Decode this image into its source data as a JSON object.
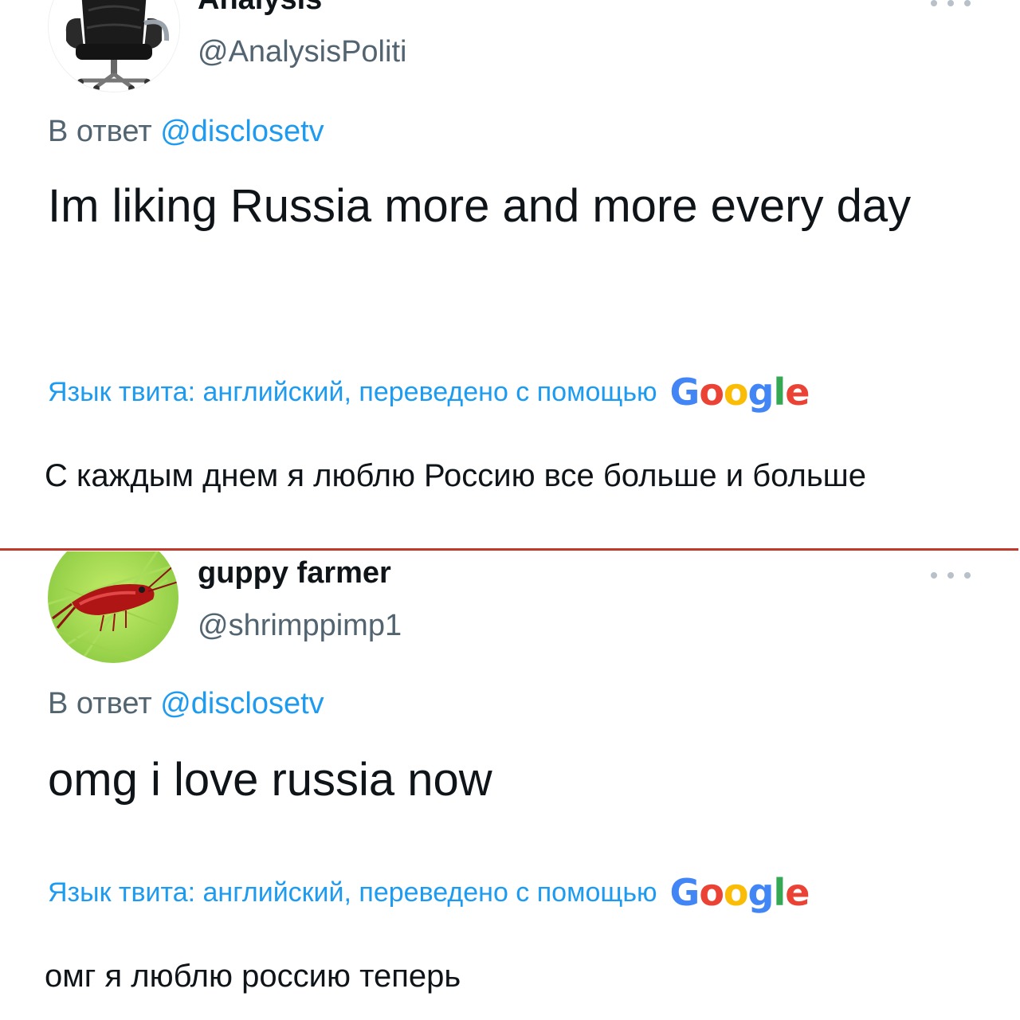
{
  "tweets": [
    {
      "display_name": "Analysis",
      "handle": "@AnalysisPoliti",
      "reply_prefix": "В ответ",
      "reply_to": "@disclosetv",
      "text": "Im liking Russia more and more every day",
      "translate_label": "Язык твита: английский, переведено с помощью",
      "translation": "С каждым днем я люблю Россию все больше и больше",
      "avatar_icon": "office-chair-icon"
    },
    {
      "display_name": "guppy farmer",
      "handle": "@shrimppimp1",
      "reply_prefix": "В ответ",
      "reply_to": "@disclosetv",
      "text": "omg i love russia now",
      "translate_label": "Язык твита: английский, переведено с помощью",
      "translation": "омг я люблю россию теперь",
      "avatar_icon": "shrimp-icon"
    }
  ],
  "google_logo": {
    "letters": [
      "G",
      "o",
      "o",
      "g",
      "l",
      "e"
    ],
    "colors": [
      "#4285F4",
      "#EA4335",
      "#FBBC05",
      "#4285F4",
      "#34A853",
      "#EA4335"
    ]
  },
  "colors": {
    "link": "#1d9bf0",
    "secondary_text": "#536471",
    "separator": "#c0392b"
  }
}
